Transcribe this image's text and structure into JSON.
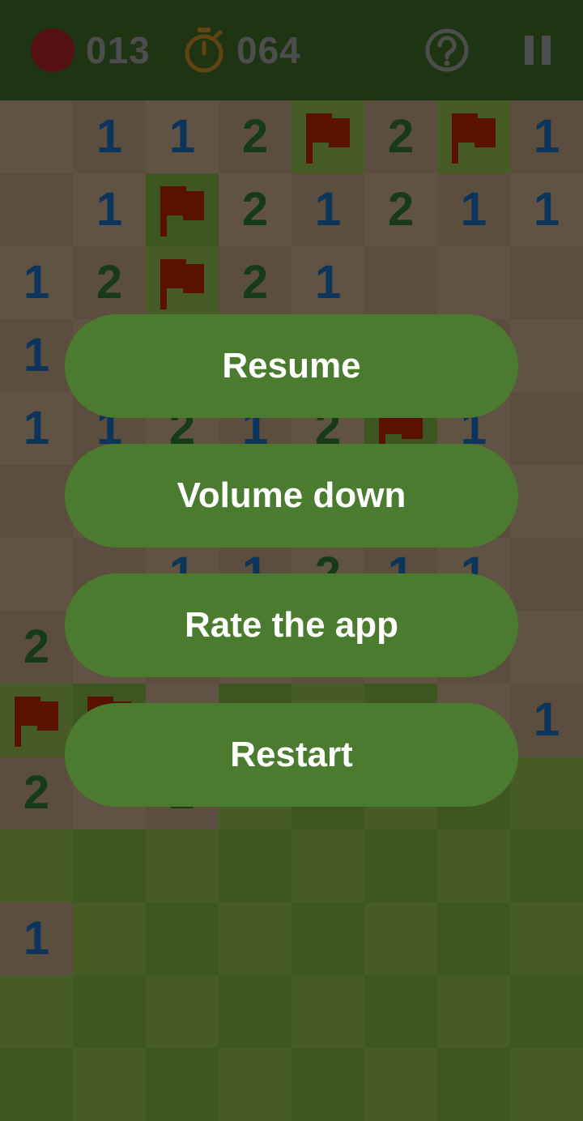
{
  "header": {
    "mines_left": "013",
    "time": "064",
    "icons": {
      "mine": "mine-counter-icon",
      "timer": "stopwatch-icon",
      "help": "help-icon",
      "pause": "pause-icon"
    }
  },
  "board": {
    "columns": 8,
    "rows": 14,
    "cells": [
      [
        "",
        "1",
        "1",
        "2",
        "F",
        "2",
        "F",
        "1"
      ],
      [
        "",
        "1",
        "F",
        "2",
        "1",
        "2",
        "1",
        "1"
      ],
      [
        "1",
        "2",
        "F",
        "2",
        "1",
        "",
        "",
        ""
      ],
      [
        "1",
        "",
        "",
        "",
        "",
        "",
        "",
        ""
      ],
      [
        "1",
        "1",
        "2",
        "1",
        "2",
        "F",
        "1",
        ""
      ],
      [
        "",
        "",
        "",
        "",
        "",
        "",
        "",
        ""
      ],
      [
        "",
        "",
        "1",
        "1",
        "2",
        "1",
        "1",
        ""
      ],
      [
        "2",
        "",
        "",
        "",
        "",
        "",
        "",
        ""
      ],
      [
        "F",
        "F",
        "",
        "#",
        "#",
        "#",
        "",
        "1"
      ],
      [
        "2",
        "",
        "2",
        "#",
        "#",
        "#",
        "#",
        "#"
      ],
      [
        "#",
        "#",
        "#",
        "#",
        "#",
        "#",
        "#",
        "#"
      ],
      [
        "1",
        "#",
        "#",
        "#",
        "#",
        "#",
        "#",
        "#"
      ],
      [
        "#",
        "#",
        "#",
        "#",
        "#",
        "#",
        "#",
        "#"
      ],
      [
        "#",
        "#",
        "#",
        "#",
        "#",
        "#",
        "#",
        "#"
      ]
    ],
    "legend": {
      "F": "flag",
      "#": "covered",
      "": "revealed-empty"
    }
  },
  "menu": {
    "resume": "Resume",
    "volume_down": "Volume down",
    "rate": "Rate the app",
    "restart": "Restart"
  },
  "colors": {
    "header_bg": "#4a7d2c",
    "button_bg": "#4a7b2e",
    "revealed_light": "#e6c7a0",
    "revealed_dark": "#d8b993",
    "covered_light": "#a6d95c",
    "covered_dark": "#93cc4d",
    "number_1": "#1f7cd6",
    "number_2": "#378d3a",
    "flag": "#d62d00",
    "mine": "#d0282d",
    "timer": "#e7a22d"
  }
}
